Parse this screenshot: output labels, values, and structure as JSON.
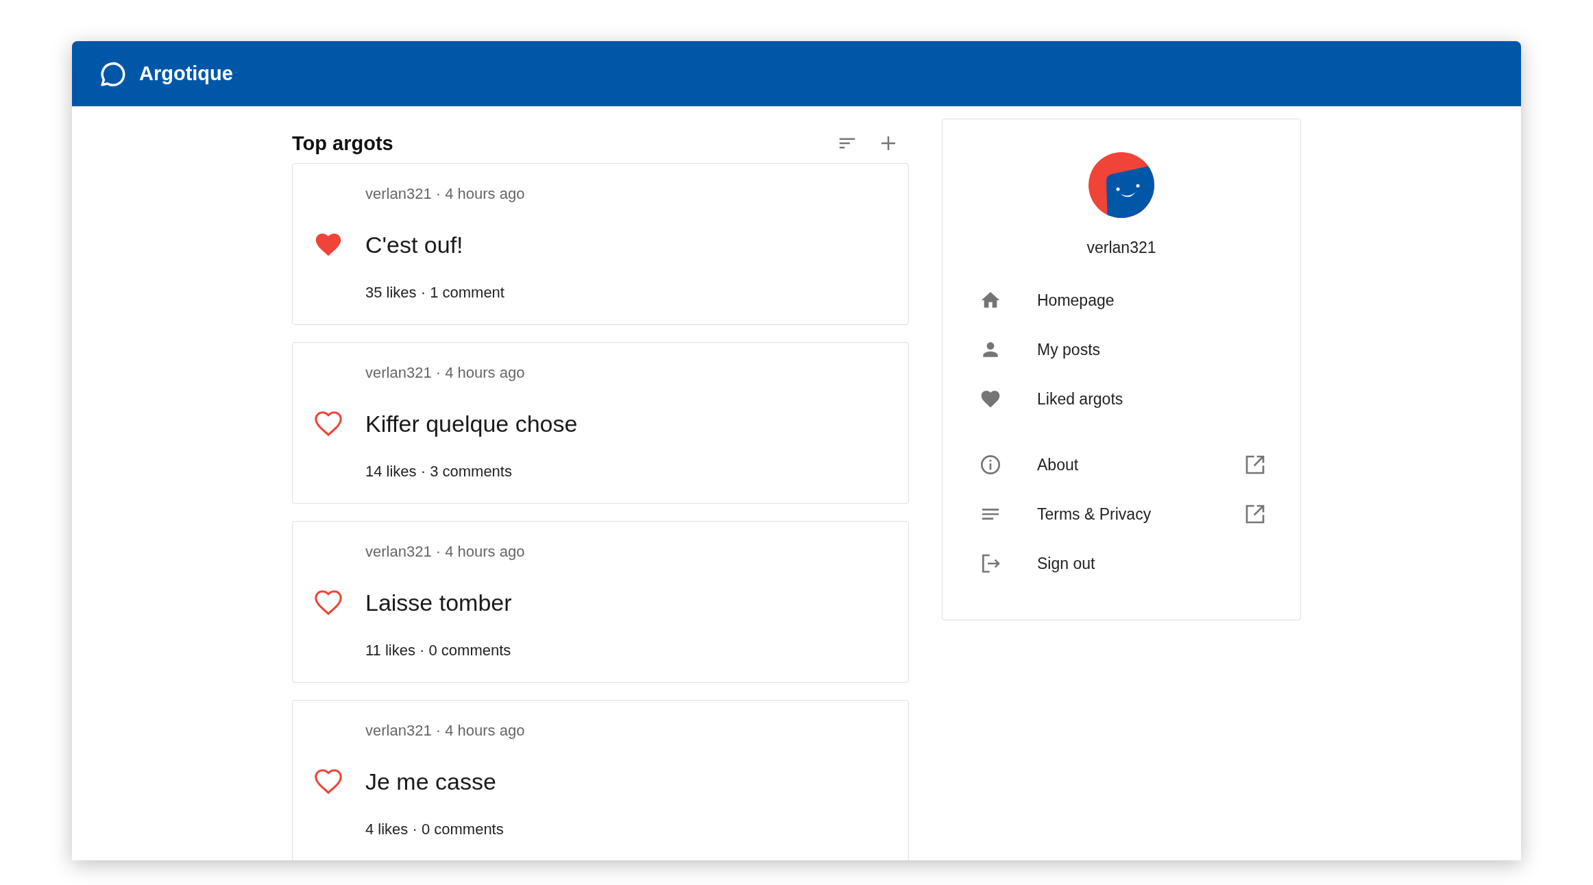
{
  "header": {
    "brand": "Argotique"
  },
  "feed": {
    "title": "Top argots",
    "posts": [
      {
        "meta": "verlan321 · 4 hours ago",
        "title": "C'est ouf!",
        "stats": "35 likes · 1 comment",
        "liked": true
      },
      {
        "meta": "verlan321 · 4 hours ago",
        "title": "Kiffer quelque chose",
        "stats": "14 likes · 3 comments",
        "liked": false
      },
      {
        "meta": "verlan321 · 4 hours ago",
        "title": "Laisse tomber",
        "stats": "11 likes · 0 comments",
        "liked": false
      },
      {
        "meta": "verlan321 · 4 hours ago",
        "title": "Je me casse",
        "stats": "4 likes · 0 comments",
        "liked": false
      }
    ]
  },
  "profile": {
    "username": "verlan321",
    "menu_sections": [
      [
        {
          "kind": "home",
          "label": "Homepage",
          "external": false
        },
        {
          "kind": "person",
          "label": "My posts",
          "external": false
        },
        {
          "kind": "heart",
          "label": "Liked argots",
          "external": false
        }
      ],
      [
        {
          "kind": "info",
          "label": "About",
          "external": true
        },
        {
          "kind": "lines",
          "label": "Terms & Privacy",
          "external": true
        },
        {
          "kind": "signout",
          "label": "Sign out",
          "external": false
        }
      ]
    ]
  }
}
